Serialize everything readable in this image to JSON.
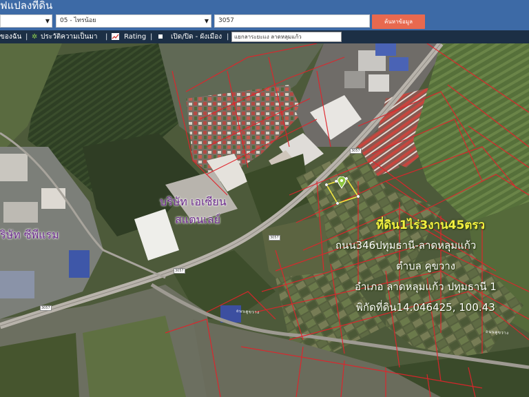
{
  "header": {
    "title": "ฟแปลงที่ดิน",
    "province_value": "",
    "district_value": "05 - ไทรน้อย",
    "parcel_value": "3057",
    "search_label": "ค้นหาข้อมูล"
  },
  "toolbar": {
    "item1": "ของฉัน",
    "item2": "ประวัติความเป็นมา",
    "item3": "Rating",
    "item4": "เปิด/ปิด - ผังเมือง",
    "place_search_value": "แยกลาระยะแง ลาดหลุมแก้ว",
    "separator": "|"
  },
  "map": {
    "company1": "บริษัท เอเซียน",
    "company1_line2": "สแตนเลย์",
    "company2": "ริษัท ซีพีแรม",
    "info_title": "ที่ดิน1ไร่3งาน45ตรว",
    "info_road": "ถนน346ปทุมธานี-ลาดหลุมแก้ว",
    "info_subdistrict": "ตำบล คูขวาง",
    "info_district": "อำเภอ ลาดหลุมแก้ว ปทุมธานี 1",
    "info_coord": "พิกัดที่ดิน14.046425, 100.43",
    "road_name": "ถนนคูขวาง",
    "badge1": "3057",
    "badge2": "3057",
    "badge3": "3057",
    "badge4": "3057"
  },
  "colors": {
    "header_bg": "#3d6aa6",
    "toolbar_bg": "#1c2f45",
    "search_button": "#e8694f",
    "parcel_line": "#e0242b",
    "selected_parcel": "#f2e640",
    "company_label": "#6a2a8a",
    "info_title": "#f2f040"
  },
  "icons": {
    "toolbar_item2": "tree-icon",
    "toolbar_item3": "chart-icon",
    "toolbar_item4": "checkbox-icon",
    "map_marker": "map-pin-icon"
  }
}
